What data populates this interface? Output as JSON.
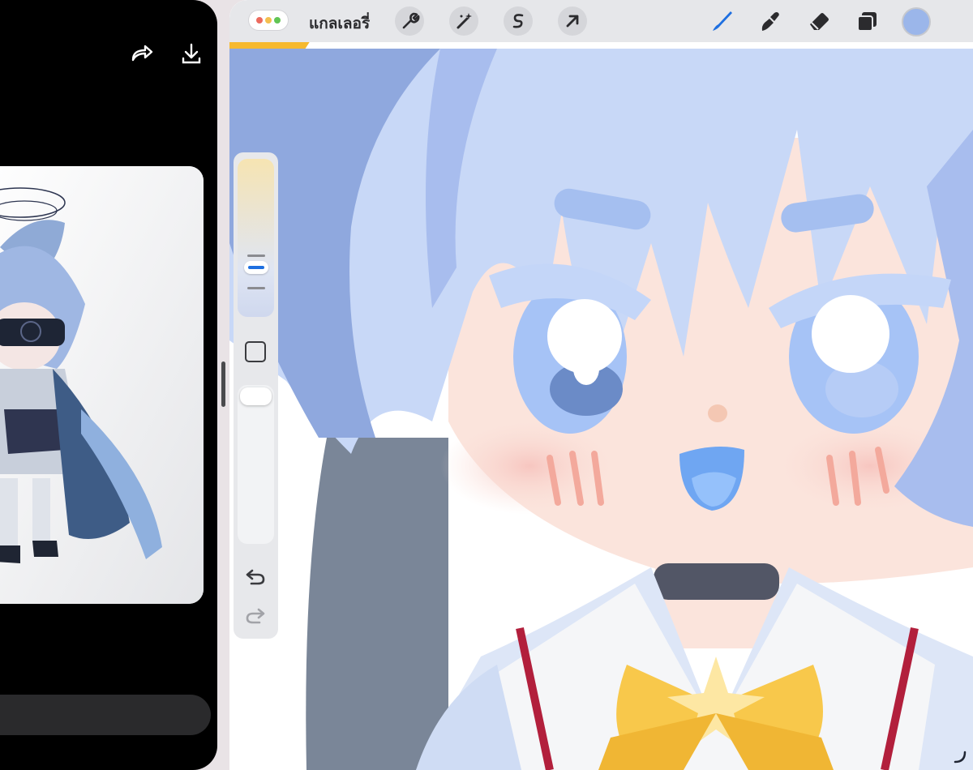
{
  "left_window": {
    "icons": [
      "share-icon",
      "download-icon"
    ]
  },
  "toolbar": {
    "gallery_label": "แกลเลอรี่",
    "left_tools": [
      "wrench-icon",
      "magic-wand-icon",
      "selection-icon",
      "transform-arrow-icon"
    ],
    "right_tools": [
      "brush-icon",
      "smudge-icon",
      "eraser-icon",
      "layers-icon"
    ],
    "current_color": "#9bb6ea"
  },
  "sidebar": {
    "tools": [
      "brush-size-slider",
      "modify-button",
      "opacity-slider",
      "undo-icon",
      "redo-icon"
    ]
  },
  "colors": {
    "traffic_red": "#ec6a5e",
    "traffic_yellow": "#f4bf4f",
    "traffic_green": "#61c554",
    "accent_blue": "#1e6fe0"
  }
}
